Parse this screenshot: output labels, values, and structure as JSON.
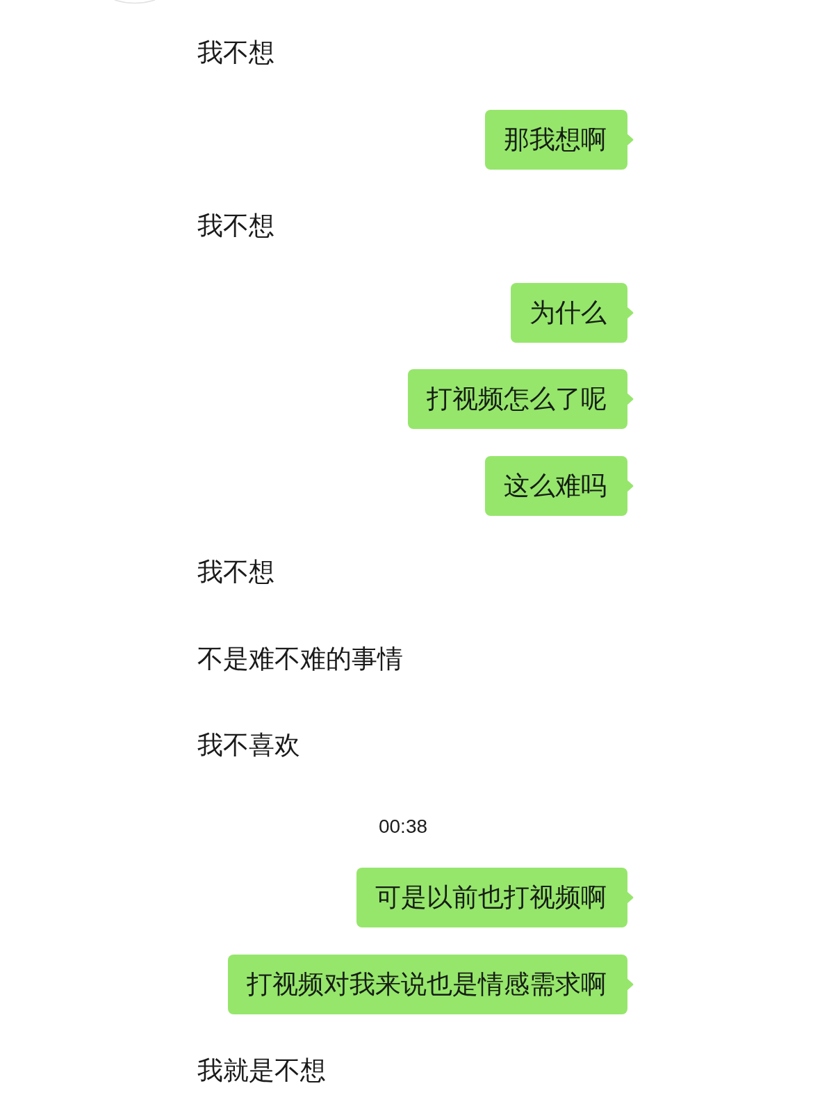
{
  "chat": {
    "messages": [
      {
        "kind": "received",
        "text": "我不想"
      },
      {
        "kind": "sent",
        "text": "那我想啊"
      },
      {
        "kind": "received",
        "text": "我不想"
      },
      {
        "kind": "sent",
        "text": "为什么"
      },
      {
        "kind": "sent",
        "text": "打视频怎么了呢"
      },
      {
        "kind": "sent",
        "text": "这么难吗"
      },
      {
        "kind": "received",
        "text": "我不想"
      },
      {
        "kind": "received",
        "text": "不是难不难的事情"
      },
      {
        "kind": "received",
        "text": "我不喜欢"
      },
      {
        "kind": "time",
        "text": "00:38"
      },
      {
        "kind": "sent",
        "text": "可是以前也打视频啊"
      },
      {
        "kind": "sent",
        "text": "打视频对我来说也是情感需求啊"
      },
      {
        "kind": "received",
        "text": "我就是不想"
      }
    ]
  }
}
